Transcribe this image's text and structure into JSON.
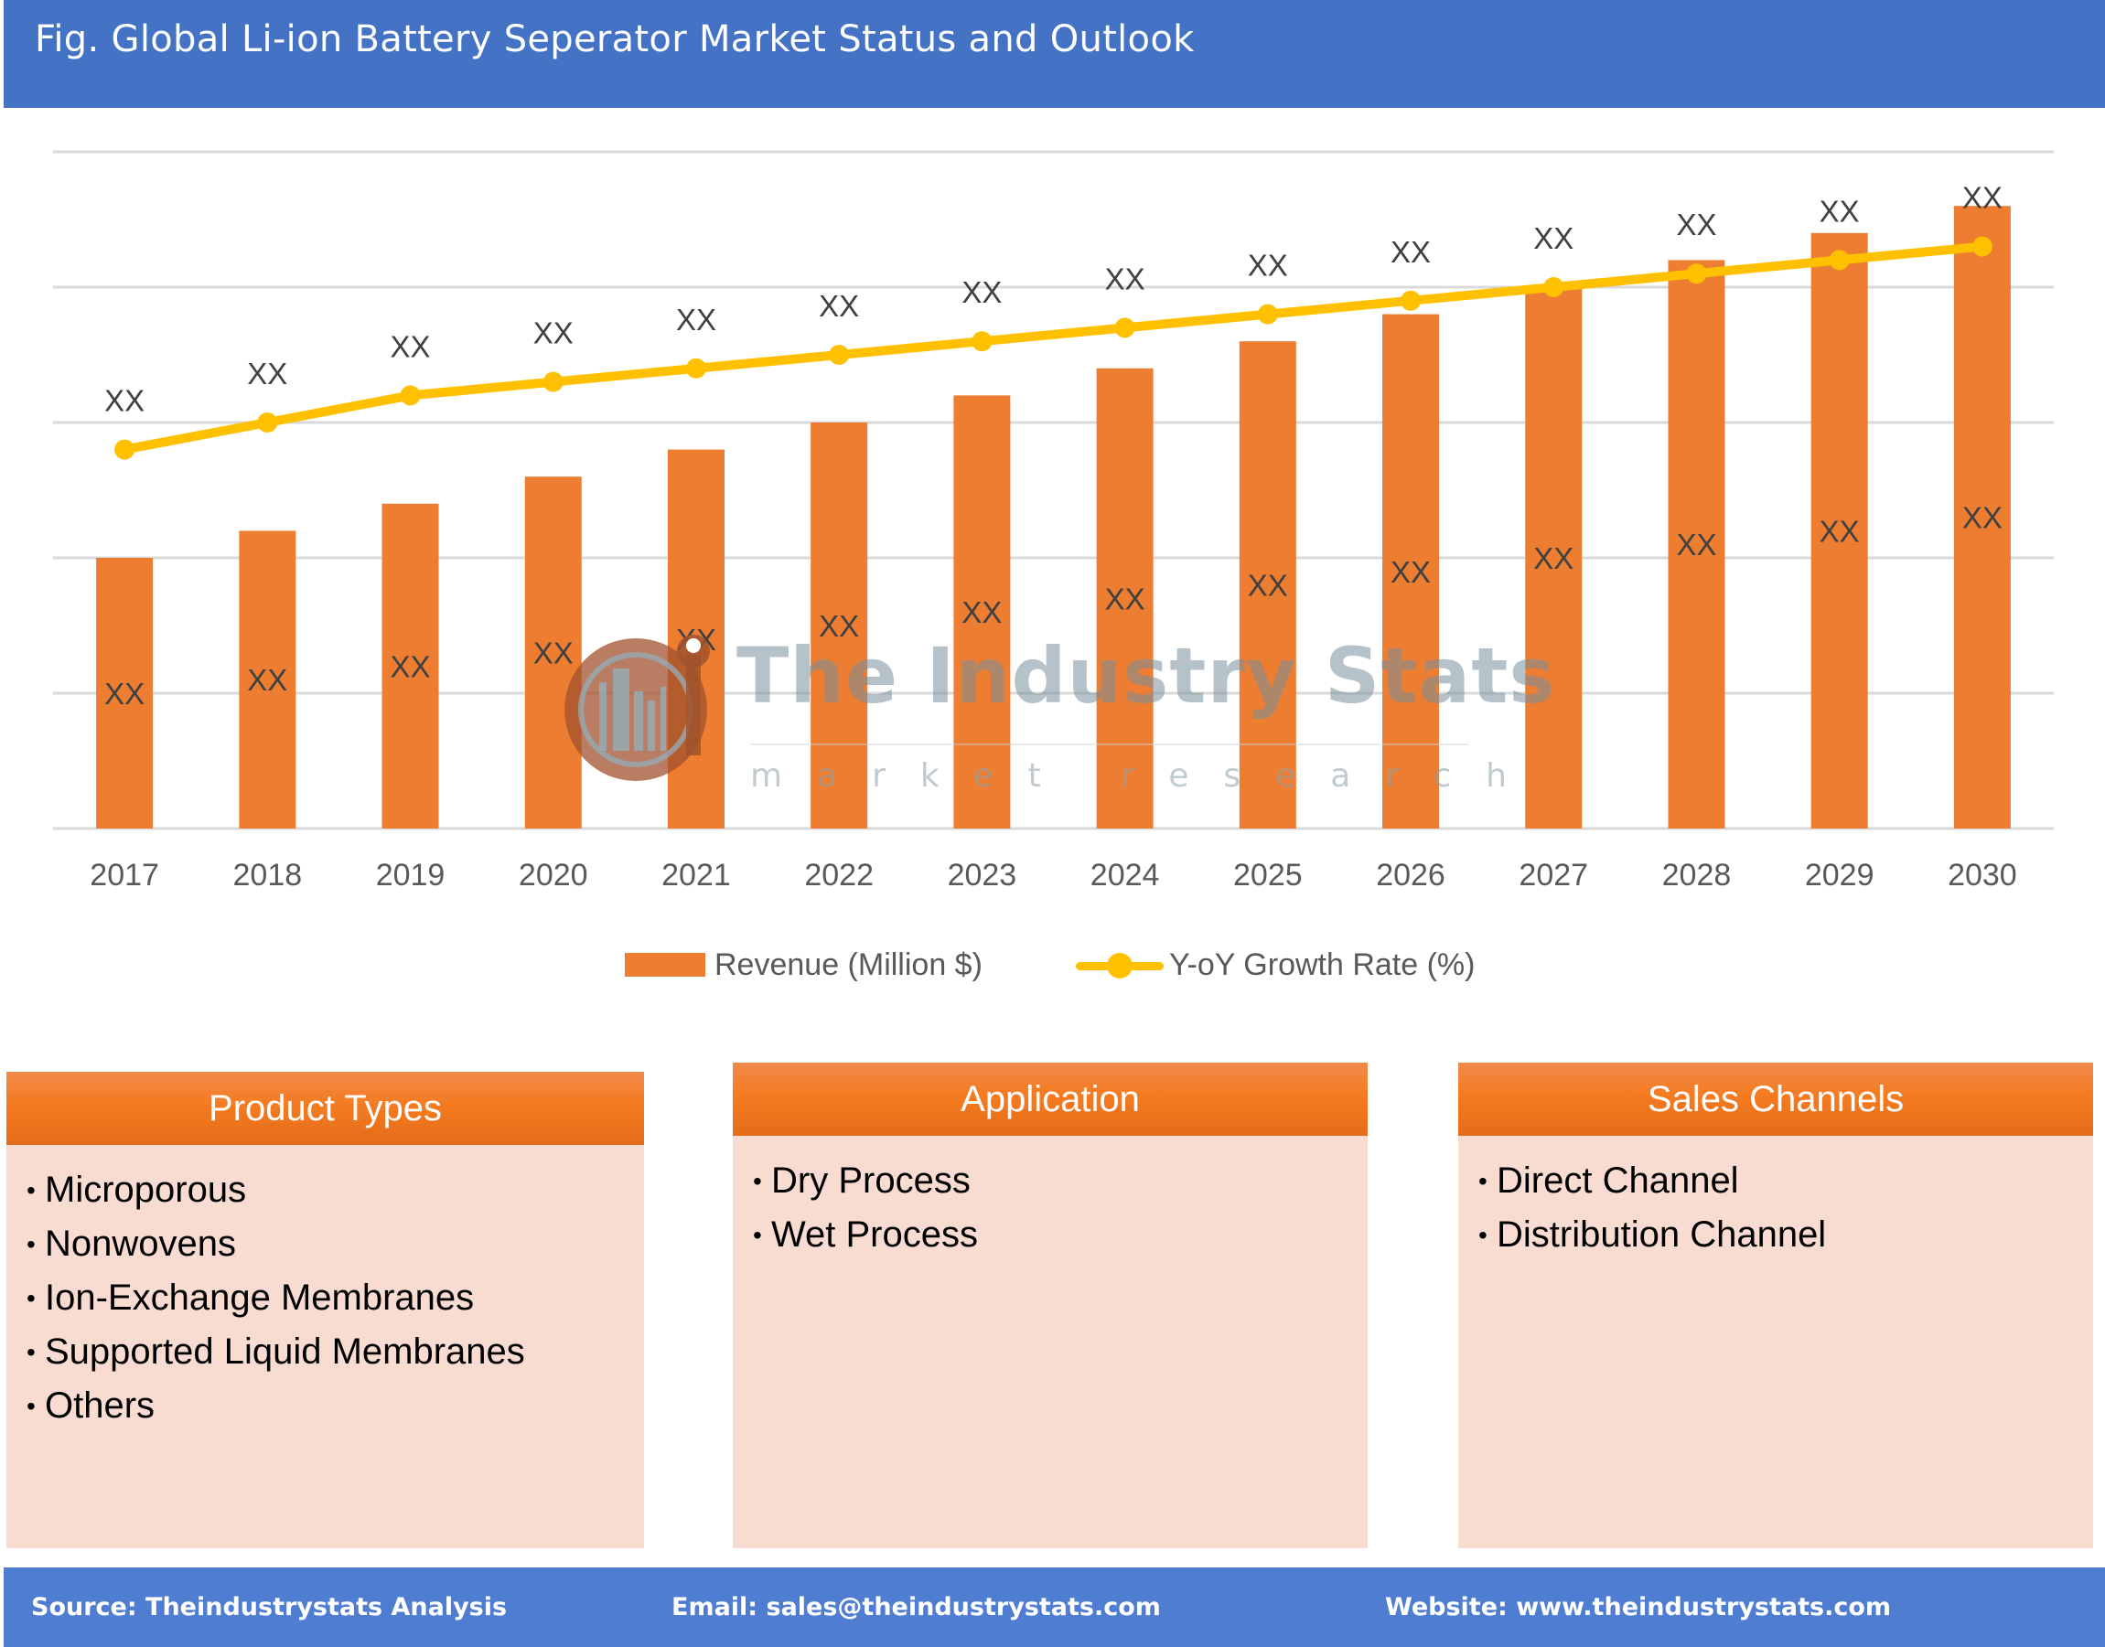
{
  "header": {
    "title": "Fig. Global Li-ion Battery Seperator Market Status and Outlook"
  },
  "colors": {
    "header_bg": "#4472c4",
    "bar": "#ed7d31",
    "line": "#ffc000",
    "box_header": "#f47b20",
    "box_body": "#f8dbd1",
    "footer_bg": "#4f7dd1"
  },
  "chart_data": {
    "type": "bar",
    "title": "Fig. Global Li-ion Battery Seperator Market Status and Outlook",
    "xlabel": "",
    "ylabel": "",
    "categories": [
      "2017",
      "2018",
      "2019",
      "2020",
      "2021",
      "2022",
      "2023",
      "2024",
      "2025",
      "2026",
      "2027",
      "2028",
      "2029",
      "2030"
    ],
    "ylim": [
      0,
      5
    ],
    "grid": true,
    "y_axis_labels_shown": false,
    "legend_position": "bottom",
    "value_units_note": "Values are hidden in the image (labeled XX); heights estimated in gridline units",
    "series": [
      {
        "name": "Revenue (Million $)",
        "type": "bar",
        "color": "#ed7d31",
        "values": [
          2.0,
          2.2,
          2.4,
          2.6,
          2.8,
          3.0,
          3.2,
          3.4,
          3.6,
          3.8,
          4.0,
          4.2,
          4.4,
          4.6
        ],
        "data_labels": [
          "XX",
          "XX",
          "XX",
          "XX",
          "XX",
          "XX",
          "XX",
          "XX",
          "XX",
          "XX",
          "XX",
          "XX",
          "XX",
          "XX"
        ]
      },
      {
        "name": "Y-oY Growth Rate (%)",
        "type": "line",
        "color": "#ffc000",
        "values": [
          2.8,
          3.0,
          3.2,
          3.3,
          3.4,
          3.5,
          3.6,
          3.7,
          3.8,
          3.9,
          4.0,
          4.1,
          4.2,
          4.3
        ],
        "data_labels": [
          "XX",
          "XX",
          "XX",
          "XX",
          "XX",
          "XX",
          "XX",
          "XX",
          "XX",
          "XX",
          "XX",
          "XX",
          "XX",
          "XX"
        ]
      }
    ]
  },
  "legend": {
    "bar_label": "Revenue (Million $)",
    "line_label": "Y-oY Growth Rate (%)"
  },
  "watermark": {
    "title": "The Industry Stats",
    "subtitle": "market research"
  },
  "boxes": [
    {
      "title": "Product Types",
      "items": [
        "Microporous",
        "Nonwovens",
        "Ion-Exchange Membranes",
        "Supported Liquid Membranes",
        "Others"
      ]
    },
    {
      "title": "Application",
      "items": [
        "Dry Process",
        "Wet Process"
      ]
    },
    {
      "title": "Sales Channels",
      "items": [
        "Direct Channel",
        "Distribution Channel"
      ]
    }
  ],
  "bullet": "•",
  "footer": {
    "source": "Source: Theindustrystats Analysis",
    "email": "Email: sales@theindustrystats.com",
    "website": "Website: www.theindustrystats.com"
  }
}
